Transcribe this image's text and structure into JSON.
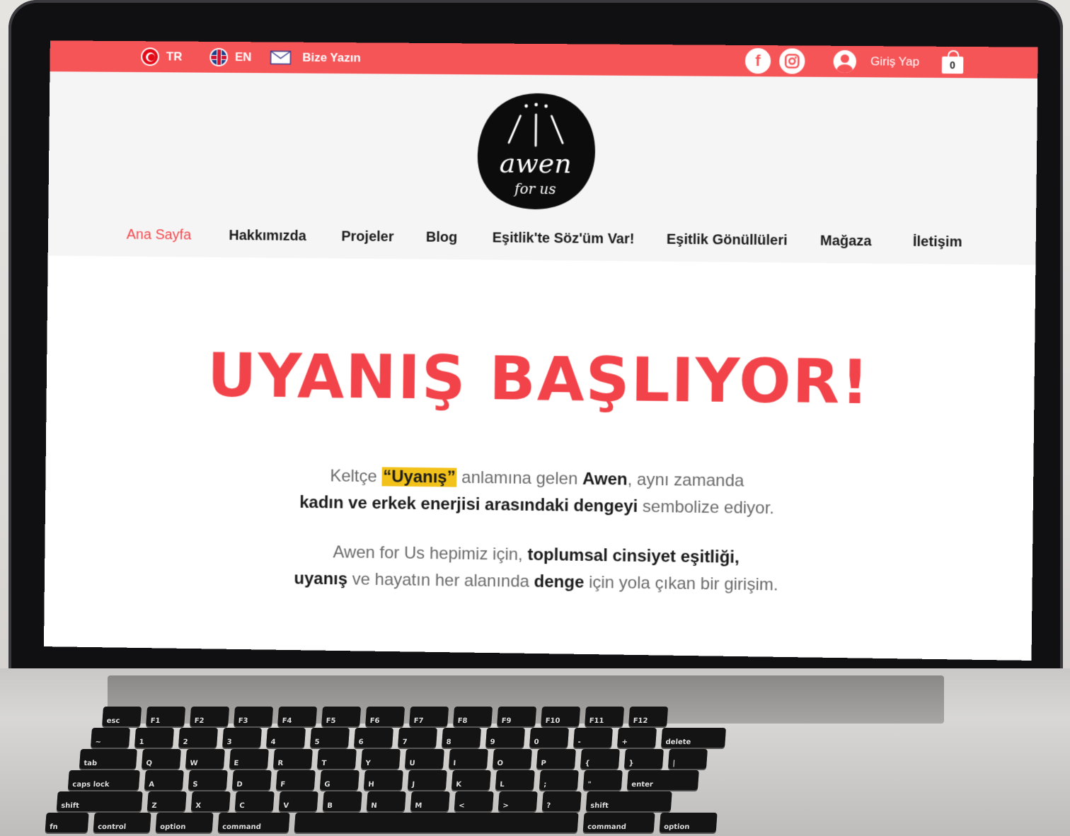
{
  "topbar": {
    "lang_tr": "TR",
    "lang_en": "EN",
    "contact": "Bize Yazın",
    "facebook_glyph": "f",
    "login": "Giriş Yap",
    "cart_count": "0"
  },
  "logo": {
    "line1": "awen",
    "line2": "for us"
  },
  "nav": {
    "items": [
      {
        "label": "Ana Sayfa"
      },
      {
        "label": "Hakkımızda"
      },
      {
        "label": "Projeler"
      },
      {
        "label": "Blog"
      },
      {
        "label": "Eşitlik'te Söz'üm Var!"
      },
      {
        "label": "Eşitlik Gönüllüleri"
      },
      {
        "label": "Mağaza"
      },
      {
        "label": "İletişim"
      }
    ]
  },
  "hero": {
    "title": "UYANIŞ BAŞLIYOR!",
    "p1_a": "Keltçe ",
    "p1_hl": "“Uyanış”",
    "p1_b": " anlamına gelen ",
    "p1_awen": "Awen",
    "p1_c": ", aynı zamanda",
    "p1_d": "kadın ve erkek enerjisi arasındaki dengeyi",
    "p1_e": " sembolize ediyor.",
    "p2_a": "Awen for Us hepimiz için, ",
    "p2_b": "toplumsal cinsiyet eşitliği,",
    "p2_c": "uyanış",
    "p2_d": " ve hayatın her alanında ",
    "p2_e": "denge",
    "p2_f": " için yola çıkan bir girişim."
  },
  "keyboard": {
    "row1": [
      "esc",
      "F1",
      "F2",
      "F3",
      "F4",
      "F5",
      "F6",
      "F7",
      "F8",
      "F9",
      "F10",
      "F11",
      "F12"
    ],
    "row2": [
      "~",
      "1",
      "2",
      "3",
      "4",
      "5",
      "6",
      "7",
      "8",
      "9",
      "0",
      "-",
      "+",
      "delete"
    ],
    "row3": [
      "tab",
      "Q",
      "W",
      "E",
      "R",
      "T",
      "Y",
      "U",
      "I",
      "O",
      "P",
      "{",
      "}",
      "|"
    ],
    "row4": [
      "caps lock",
      "A",
      "S",
      "D",
      "F",
      "G",
      "H",
      "J",
      "K",
      "L",
      ";",
      "\"",
      "enter"
    ],
    "row5": [
      "shift",
      "Z",
      "X",
      "C",
      "V",
      "B",
      "N",
      "M",
      "<",
      ">",
      "?",
      "shift"
    ],
    "row6": [
      "fn",
      "control",
      "option",
      "command",
      "",
      "command",
      "option"
    ]
  },
  "colors": {
    "brand_red": "#f65558",
    "title_red": "#f2434a",
    "highlight": "#f3c21a"
  }
}
